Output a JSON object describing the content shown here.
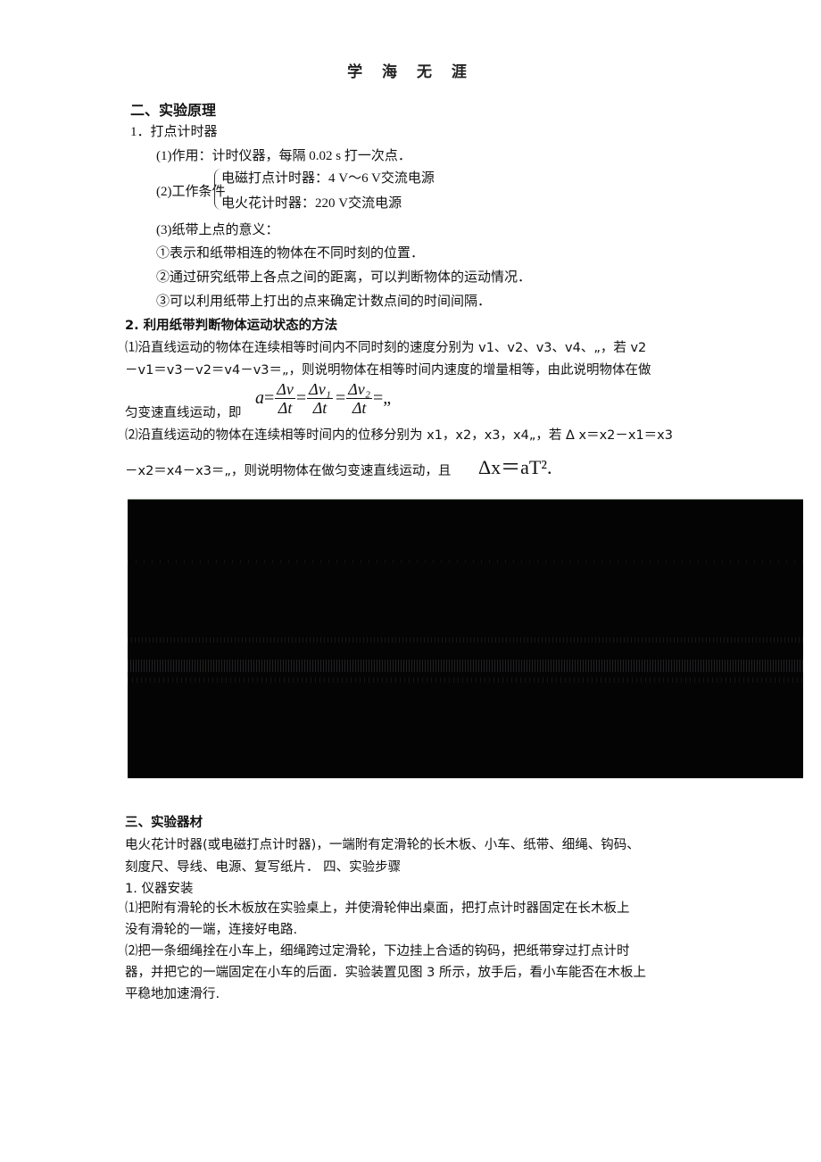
{
  "header": {
    "title": "学 海 无  涯"
  },
  "section2": {
    "heading": "二、实验原理",
    "item1": {
      "title": "1．打点计时器",
      "function_line": "(1)作用：计时仪器，每隔 0.02 s 打一次点．",
      "conditions_label": "(2)工作条件",
      "conditions": [
        "电磁打点计时器：4 V～6 V交流电源",
        "电火花计时器：220 V交流电源"
      ],
      "meaning_title": "(3)纸带上点的意义：",
      "meanings": [
        "①表示和纸带相连的物体在不同时刻的位置．",
        "②通过研究纸带上各点之间的距离，可以判断物体的运动情况．",
        "③可以利用纸带上打出的点来确定计数点间的时间间隔．"
      ]
    },
    "item2": {
      "title": "2.  利用纸带判断物体运动状态的方法",
      "para1_lines": [
        "⑴沿直线运动的物体在连续相等时间内不同时刻的速度分别为  v1、v2、v3、v4、„，若  v2",
        "－v1＝v3－v2＝v4－v3＝„，则说明物体在相等时间内速度的增量相等，由此说明物体在做",
        "匀变速直线运动，即"
      ],
      "formula1": {
        "lhs": "a",
        "fracs": [
          {
            "num": "Δv",
            "den": "Δt"
          },
          {
            "num": "Δv₁",
            "den": "Δt"
          },
          {
            "num": "Δv₂",
            "den": "Δt"
          }
        ],
        "tail": "=„"
      },
      "para2_lines": [
        "⑵沿直线运动的物体在连续相等时间内的位移分别为 x1，x2，x3，x4„，若 Δ x＝x2－x1＝x3",
        "－x2＝x4－x3＝„，则说明物体在做匀变速直线运动，且"
      ],
      "formula2": "Δx＝aT²."
    }
  },
  "figure": {
    "description": "dark embedded image (unreadable, mostly black)"
  },
  "section3": {
    "heading": "三、实验器材",
    "lines": [
      "电火花计时器(或电磁打点计时器)，一端附有定滑轮的长木板、小车、纸带、细绳、钩码、",
      "刻度尺、导线、电源、复写纸片．  四、实验步骤"
    ]
  },
  "section4": {
    "step1_title": "1.  仪器安装",
    "para1_lines": [
      "⑴把附有滑轮的长木板放在实验桌上，并使滑轮伸出桌面，把打点计时器固定在长木板上",
      "没有滑轮的一端，连接好电路."
    ],
    "para2_lines": [
      "⑵把一条细绳拴在小车上，细绳跨过定滑轮，下边挂上合适的钩码，把纸带穿过打点计时",
      "器，并把它的一端固定在小车的后面．实验装置见图 3 所示，放手后，看小车能否在木板上",
      "平稳地加速滑行."
    ]
  }
}
